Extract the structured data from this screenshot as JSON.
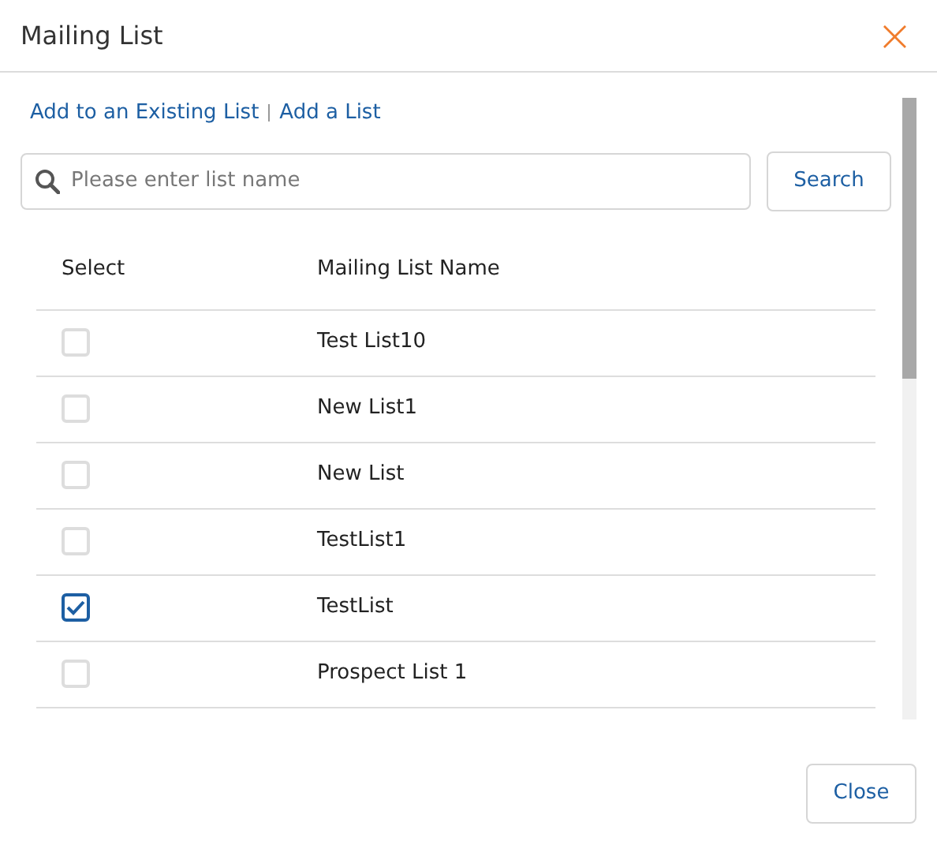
{
  "dialog": {
    "title": "Mailing List",
    "close_icon": "×"
  },
  "links": [
    "Add to an Existing List",
    "Add a List"
  ],
  "search": {
    "placeholder": "Please enter list name",
    "button": "Search"
  },
  "table": {
    "columns": [
      "Select",
      "Mailing List Name"
    ],
    "rows": [
      {
        "name": "Test List10",
        "checked": false
      },
      {
        "name": "New List1",
        "checked": false
      },
      {
        "name": "New List",
        "checked": false
      },
      {
        "name": "TestList1",
        "checked": false
      },
      {
        "name": "TestList",
        "checked": true
      },
      {
        "name": "Prospect List 1",
        "checked": false
      }
    ]
  },
  "buttons": [
    "Close"
  ]
}
